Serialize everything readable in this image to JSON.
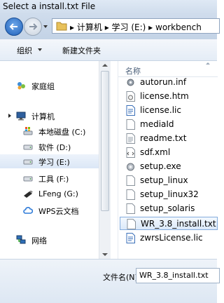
{
  "window": {
    "title": "Select a install.txt File"
  },
  "navigation": {
    "breadcrumb": [
      "计算机",
      "学习 (E:)",
      "workbench"
    ]
  },
  "toolbar": {
    "organize_label": "组织",
    "new_folder_label": "新建文件夹"
  },
  "sidebar": {
    "homegroup_label": "家庭组",
    "computer_label": "计算机",
    "drives": [
      {
        "label": "本地磁盘 (C:)",
        "icon": "system-drive-icon"
      },
      {
        "label": "软件 (D:)",
        "icon": "drive-icon"
      },
      {
        "label": "学习 (E:)",
        "icon": "drive-icon",
        "selected": true
      },
      {
        "label": "工具 (F:)",
        "icon": "drive-icon"
      },
      {
        "label": "LFeng (G:)",
        "icon": "usb-drive-icon"
      },
      {
        "label": "WPS云文档",
        "icon": "cloud-icon"
      }
    ],
    "network_label": "网络"
  },
  "file_list": {
    "column_header": "名称",
    "files": [
      {
        "name": "autorun.inf",
        "icon": "settings-file-icon"
      },
      {
        "name": "license.htm",
        "icon": "html-file-icon"
      },
      {
        "name": "license.lic",
        "icon": "document-file-icon"
      },
      {
        "name": "mediaId",
        "icon": "blank-file-icon"
      },
      {
        "name": "readme.txt",
        "icon": "text-file-icon"
      },
      {
        "name": "sdf.xml",
        "icon": "xml-file-icon"
      },
      {
        "name": "setup.exe",
        "icon": "installer-icon"
      },
      {
        "name": "setup_linux",
        "icon": "blank-file-icon"
      },
      {
        "name": "setup_linux32",
        "icon": "blank-file-icon"
      },
      {
        "name": "setup_solaris",
        "icon": "blank-file-icon"
      },
      {
        "name": "WR_3.8_install.txt",
        "icon": "blank-file-icon",
        "selected": true
      },
      {
        "name": "zwrsLicense.lic",
        "icon": "document-file-icon"
      }
    ]
  },
  "filename": {
    "label": "文件名(N):",
    "value": "WR_3.8_install.txt"
  }
}
